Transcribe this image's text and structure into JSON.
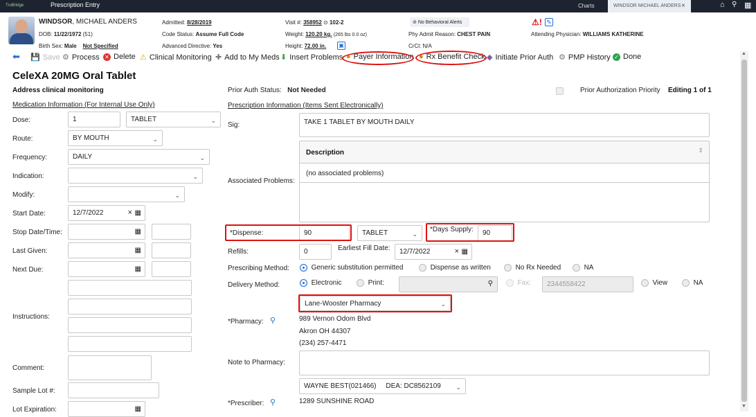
{
  "topbar": {
    "logo": "TruBridge",
    "title": "Prescription Entry",
    "charts": "Charts",
    "patient_tab": "WINDSOR MICHAEL ANDERS",
    "close": "×"
  },
  "patient": {
    "last": "WINDSOR",
    "first": ", MICHAEL ANDERS",
    "dob_label": "DOB:",
    "dob": "11/22/1972",
    "age": "(51)",
    "sex_label": "Birth Sex:",
    "sex": "Male",
    "not_specified": "Not Specified",
    "admitted_label": "Admitted:",
    "admitted": "8/28/2019",
    "code_label": "Code Status:",
    "code": "Assume Full Code",
    "adv_label": "Advanced Directive:",
    "adv": "Yes",
    "visit_label": "Visit #:",
    "visit": "358952",
    "room": "102-2",
    "weight_label": "Weight:",
    "weight": "120.20 kg.",
    "weight_lbs": "(265 lbs 0.0 oz)",
    "height_label": "Height:",
    "height": "72.00 in.",
    "alerts": "No Behavioral Alerts",
    "reason_label": "Phy Admit Reason:",
    "reason": "CHEST PAIN",
    "crcl_label": "CrCl:",
    "crcl": "N/A",
    "physician_label": "Attending Physician:",
    "physician": "WILLIAMS KATHERINE"
  },
  "toolbar": {
    "save": "Save",
    "process": "Process",
    "delete": "Delete",
    "clinical": "Clinical Monitoring",
    "add_meds": "Add to My Meds",
    "insert": "Insert Problems",
    "payer": "Payer Information",
    "rx_benefit": "Rx Benefit Check",
    "prior_auth": "Initiate Prior Auth",
    "pmp": "PMP History",
    "done": "Done"
  },
  "form": {
    "drug": "CeleXA 20MG Oral Tablet",
    "address_clinical": "Address clinical monitoring",
    "med_info": "Medication Information (For Internal Use Only)",
    "prior_auth_label": "Prior Auth Status:",
    "prior_auth": "Not Needed",
    "prior_priority": "Prior Authorization Priority",
    "editing": "Editing 1 of 1",
    "rx_info": "Prescription Information (Items Sent Electronically)",
    "dose_label": "Dose:",
    "dose": "1",
    "dose_unit": "TABLET",
    "route_label": "Route:",
    "route": "BY MOUTH",
    "freq_label": "Frequency:",
    "freq": "DAILY",
    "indication_label": "Indication:",
    "modify_label": "Modify:",
    "start_label": "Start Date:",
    "start": "12/7/2022",
    "stop_label": "Stop Date/Time:",
    "last_label": "Last Given:",
    "next_label": "Next Due:",
    "instructions_label": "Instructions:",
    "comment_label": "Comment:",
    "lot_label": "Sample Lot #:",
    "lotexp_label": "Lot Expiration:",
    "sig_label": "Sig:",
    "sig": "TAKE 1 TABLET BY MOUTH DAILY",
    "desc_header": "Description",
    "no_problems": "(no associated problems)",
    "assoc_label": "Associated Problems:",
    "dispense_label": "*Dispense:",
    "dispense": "90",
    "dispense_unit": "TABLET",
    "days_label": "*Days Supply:",
    "days": "90",
    "refills_label": "Refills:",
    "refills": "0",
    "earliest_label": "Earliest Fill Date:",
    "earliest": "12/7/2022",
    "method_label": "Prescribing Method:",
    "m1": "Generic substitution permitted",
    "m2": "Dispense as written",
    "m3": "No Rx Needed",
    "m4": "NA",
    "delivery_label": "Delivery Method:",
    "d1": "Electronic",
    "d2": "Print:",
    "fax_label": "Fax:",
    "fax": "2344558422",
    "view": "View",
    "d_na": "NA",
    "pharmacy_label": "*Pharmacy:",
    "pharmacy": "Lane-Wooster Pharmacy",
    "ph_addr1": "989 Vernon Odom Blvd",
    "ph_addr2": "Akron   OH   44307",
    "ph_phone": "(234) 257-4471",
    "note_label": "Note to Pharmacy:",
    "prescriber_label": "*Prescriber:",
    "prescriber": "WAYNE BEST(021466)     DEA: DC8562109",
    "pr_addr": "1289 SUNSHINE ROAD"
  },
  "colors": {
    "topbar": "#1d2430",
    "highlight": "#d11111",
    "radio": "#1d6fd6"
  }
}
